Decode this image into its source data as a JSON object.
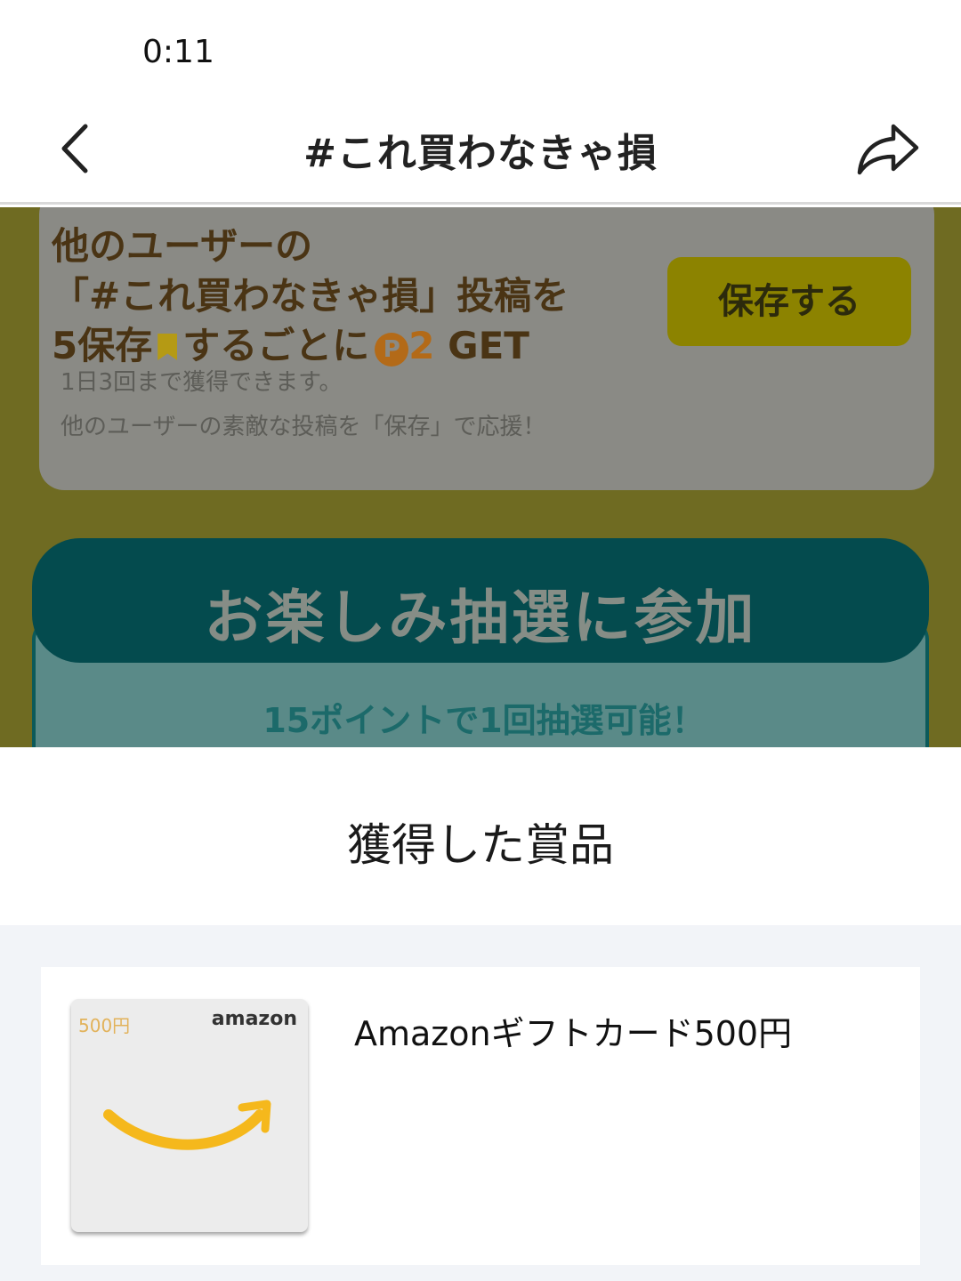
{
  "status_bar": {
    "time": "0:11"
  },
  "header": {
    "title": "#これ買わなきゃ損",
    "back_icon": "chevron-left-icon",
    "share_icon": "share-arrow-icon"
  },
  "save_card": {
    "line1": "他のユーザーの",
    "line2": "「#これ買わなきゃ損」投稿を",
    "line3_prefix": "5保存",
    "line3_mid": "するごとに",
    "points_symbol": "P",
    "points_value": "2",
    "line3_suffix": "GET",
    "note1": "1日3回まで獲得できます。",
    "note2": "他のユーザーの素敵な投稿を「保存」で応援！",
    "save_button": "保存する"
  },
  "lottery": {
    "title": "お楽しみ抽選に参加",
    "subtitle": "15ポイントで1回抽選可能！"
  },
  "prizes_sheet": {
    "title": "獲得した賞品",
    "items": [
      {
        "name": "Amazonギフトカード500円",
        "card_value_text": "500円",
        "card_brand_text": "amazon"
      }
    ]
  },
  "colors": {
    "overlay_yellow": "#6f6b22",
    "lottery_teal": "#044b4e",
    "amazon_smile": "#f5b81c"
  }
}
